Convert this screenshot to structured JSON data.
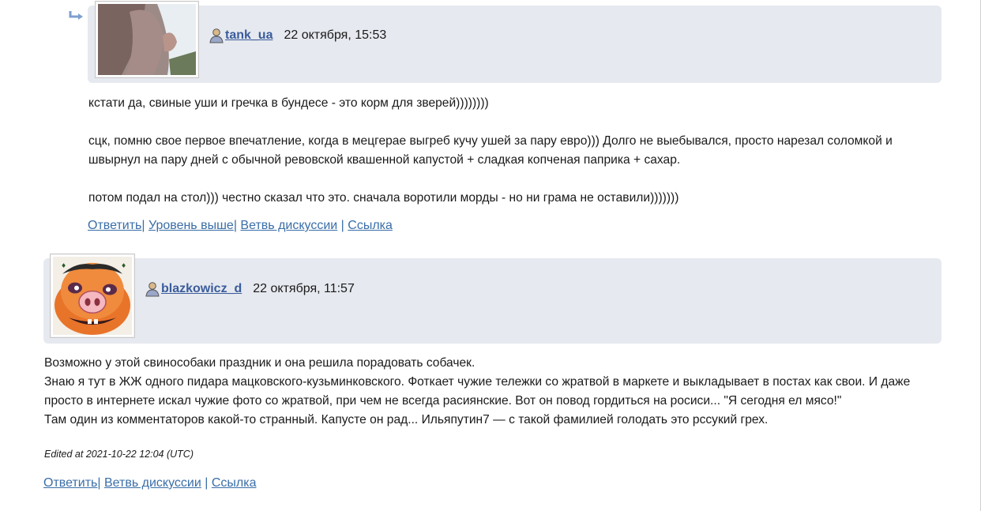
{
  "comment1": {
    "username": "tank_ua",
    "date": "22 октября, 15:53",
    "paragraphs": [
      "кстати да, свиные уши и гречка в бундесе - это корм для зверей))))))))",
      "сцк, помню свое первое впечатление, когда в мецгерае выгреб кучу ушей за пару евро))) Долго не выебывался, просто нарезал соломкой и швырнул на пару дней с обычной ревовской квашенной капустой + сладкая копченая паприка + сахар.",
      "потом подал на стол))) честно сказал что это. сначала воротили морды - но ни грама не оставили)))))))"
    ],
    "links": {
      "reply": "Ответить",
      "sep1": "|",
      "parent": "Уровень выше",
      "sep2": "|",
      "thread": "Ветвь дискуссии",
      "sep3": "|",
      "link": "Ссылка"
    }
  },
  "comment2": {
    "username": "blazkowicz_d",
    "date": "22 октября, 11:57",
    "lines": [
      "Возможно у этой свинособаки праздник и она решила порадовать собачек.",
      "Знаю я тут в ЖЖ одного пидара мацковского-кузьминковского. Фоткает чужие тележки со жратвой в маркете и выкладывает в постах как свои. И даже просто в интернете искал чужие фото со жратвой, при чем не всегда расиянские. Вот он повод гордиться на росиси... \"Я сегодня ел мясо!\"",
      "Там один из комментаторов какой-то странный. Капусте он рад... Ильяпутин7 — с такой фамилией голодать это рссукий грех."
    ],
    "edited": "Edited at 2021-10-22 12:04 (UTC)",
    "links": {
      "reply": "Ответить",
      "sep1": "|",
      "thread": "Ветвь дискуссии",
      "sep2": "|",
      "link": "Ссылка"
    }
  }
}
